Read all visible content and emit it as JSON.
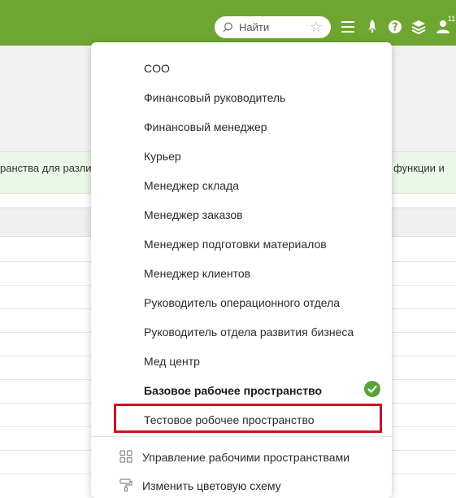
{
  "topbar": {
    "search_placeholder": "Найти",
    "notifications_count": "11",
    "colors": {
      "bar": "#6fa632"
    }
  },
  "page": {
    "notice_left": "ранства для разли",
    "notice_right": "функции и"
  },
  "workspace_menu": {
    "items": [
      "COO",
      "Финансовый руководитель",
      "Финансовый менеджер",
      "Курьер",
      "Менеджер склада",
      "Менеджер заказов",
      "Менеджер подготовки материалов",
      "Менеджер клиентов",
      "Руководитель операционного отдела",
      "Руководитель отдела развития бизнеса",
      "Мед центр"
    ],
    "active_item": "Базовое рабочее пространство",
    "highlighted_item": "Тестовое робочее пространство",
    "actions": {
      "manage": "Управление рабочими пространствами",
      "change_theme": "Изменить цветовую схему"
    },
    "colors": {
      "check": "#5aa33a",
      "highlight_border": "#c9141e"
    }
  }
}
